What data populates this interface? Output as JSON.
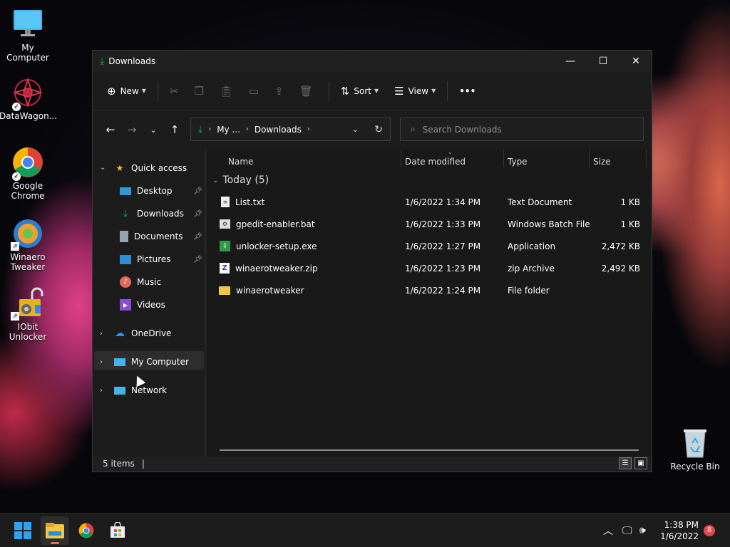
{
  "desktop": {
    "icons": [
      {
        "label": "My Computer"
      },
      {
        "label": "DataWagon..."
      },
      {
        "label": "Google Chrome"
      },
      {
        "label": "Winaero Tweaker"
      },
      {
        "label": "IObit Unlocker"
      },
      {
        "label": "Recycle Bin"
      }
    ]
  },
  "window": {
    "title": "Downloads",
    "controls": {
      "minimize": "—",
      "maximize": "☐",
      "close": "✕"
    }
  },
  "commandbar": {
    "new_label": "New",
    "sort_label": "Sort",
    "view_label": "View",
    "more_label": "•••"
  },
  "address": {
    "crumbs": [
      "My ...",
      "Downloads"
    ]
  },
  "search": {
    "placeholder": "Search Downloads"
  },
  "sidebar": {
    "quick_access": "Quick access",
    "items": [
      {
        "label": "Desktop",
        "pinned": true
      },
      {
        "label": "Downloads",
        "pinned": true
      },
      {
        "label": "Documents",
        "pinned": true
      },
      {
        "label": "Pictures",
        "pinned": true
      },
      {
        "label": "Music",
        "pinned": false
      },
      {
        "label": "Videos",
        "pinned": false
      }
    ],
    "onedrive": "OneDrive",
    "my_computer": "My Computer",
    "network": "Network"
  },
  "columns": {
    "name": "Name",
    "date": "Date modified",
    "type": "Type",
    "size": "Size"
  },
  "group": {
    "label": "Today (5)"
  },
  "files": [
    {
      "name": "List.txt",
      "date": "1/6/2022 1:34 PM",
      "type": "Text Document",
      "size": "1 KB",
      "icon": "text-file-icon"
    },
    {
      "name": "gpedit-enabler.bat",
      "date": "1/6/2022 1:33 PM",
      "type": "Windows Batch File",
      "size": "1 KB",
      "icon": "batch-file-icon"
    },
    {
      "name": "unlocker-setup.exe",
      "date": "1/6/2022 1:27 PM",
      "type": "Application",
      "size": "2,472 KB",
      "icon": "installer-icon"
    },
    {
      "name": "winaerotweaker.zip",
      "date": "1/6/2022 1:23 PM",
      "type": "zip Archive",
      "size": "2,492 KB",
      "icon": "zip-icon"
    },
    {
      "name": "winaerotweaker",
      "date": "1/6/2022 1:24 PM",
      "type": "File folder",
      "size": "",
      "icon": "folder-icon"
    }
  ],
  "status": {
    "items": "5 items"
  },
  "taskbar": {
    "time": "1:38 PM",
    "date": "1/6/2022",
    "notifications": "8"
  },
  "colors": {
    "accent_green": "#2ea043",
    "folder_yellow": "#f2c744",
    "windows_blue": "#2ea3f2"
  }
}
